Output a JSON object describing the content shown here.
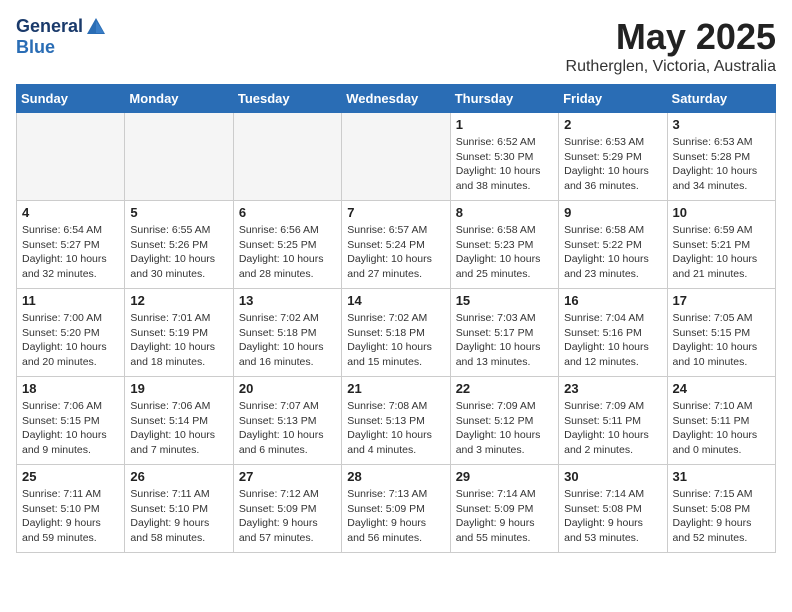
{
  "logo": {
    "line1": "General",
    "line2": "Blue"
  },
  "title": "May 2025",
  "subtitle": "Rutherglen, Victoria, Australia",
  "weekdays": [
    "Sunday",
    "Monday",
    "Tuesday",
    "Wednesday",
    "Thursday",
    "Friday",
    "Saturday"
  ],
  "weeks": [
    [
      {
        "day": "",
        "info": ""
      },
      {
        "day": "",
        "info": ""
      },
      {
        "day": "",
        "info": ""
      },
      {
        "day": "",
        "info": ""
      },
      {
        "day": "1",
        "info": "Sunrise: 6:52 AM\nSunset: 5:30 PM\nDaylight: 10 hours\nand 38 minutes."
      },
      {
        "day": "2",
        "info": "Sunrise: 6:53 AM\nSunset: 5:29 PM\nDaylight: 10 hours\nand 36 minutes."
      },
      {
        "day": "3",
        "info": "Sunrise: 6:53 AM\nSunset: 5:28 PM\nDaylight: 10 hours\nand 34 minutes."
      }
    ],
    [
      {
        "day": "4",
        "info": "Sunrise: 6:54 AM\nSunset: 5:27 PM\nDaylight: 10 hours\nand 32 minutes."
      },
      {
        "day": "5",
        "info": "Sunrise: 6:55 AM\nSunset: 5:26 PM\nDaylight: 10 hours\nand 30 minutes."
      },
      {
        "day": "6",
        "info": "Sunrise: 6:56 AM\nSunset: 5:25 PM\nDaylight: 10 hours\nand 28 minutes."
      },
      {
        "day": "7",
        "info": "Sunrise: 6:57 AM\nSunset: 5:24 PM\nDaylight: 10 hours\nand 27 minutes."
      },
      {
        "day": "8",
        "info": "Sunrise: 6:58 AM\nSunset: 5:23 PM\nDaylight: 10 hours\nand 25 minutes."
      },
      {
        "day": "9",
        "info": "Sunrise: 6:58 AM\nSunset: 5:22 PM\nDaylight: 10 hours\nand 23 minutes."
      },
      {
        "day": "10",
        "info": "Sunrise: 6:59 AM\nSunset: 5:21 PM\nDaylight: 10 hours\nand 21 minutes."
      }
    ],
    [
      {
        "day": "11",
        "info": "Sunrise: 7:00 AM\nSunset: 5:20 PM\nDaylight: 10 hours\nand 20 minutes."
      },
      {
        "day": "12",
        "info": "Sunrise: 7:01 AM\nSunset: 5:19 PM\nDaylight: 10 hours\nand 18 minutes."
      },
      {
        "day": "13",
        "info": "Sunrise: 7:02 AM\nSunset: 5:18 PM\nDaylight: 10 hours\nand 16 minutes."
      },
      {
        "day": "14",
        "info": "Sunrise: 7:02 AM\nSunset: 5:18 PM\nDaylight: 10 hours\nand 15 minutes."
      },
      {
        "day": "15",
        "info": "Sunrise: 7:03 AM\nSunset: 5:17 PM\nDaylight: 10 hours\nand 13 minutes."
      },
      {
        "day": "16",
        "info": "Sunrise: 7:04 AM\nSunset: 5:16 PM\nDaylight: 10 hours\nand 12 minutes."
      },
      {
        "day": "17",
        "info": "Sunrise: 7:05 AM\nSunset: 5:15 PM\nDaylight: 10 hours\nand 10 minutes."
      }
    ],
    [
      {
        "day": "18",
        "info": "Sunrise: 7:06 AM\nSunset: 5:15 PM\nDaylight: 10 hours\nand 9 minutes."
      },
      {
        "day": "19",
        "info": "Sunrise: 7:06 AM\nSunset: 5:14 PM\nDaylight: 10 hours\nand 7 minutes."
      },
      {
        "day": "20",
        "info": "Sunrise: 7:07 AM\nSunset: 5:13 PM\nDaylight: 10 hours\nand 6 minutes."
      },
      {
        "day": "21",
        "info": "Sunrise: 7:08 AM\nSunset: 5:13 PM\nDaylight: 10 hours\nand 4 minutes."
      },
      {
        "day": "22",
        "info": "Sunrise: 7:09 AM\nSunset: 5:12 PM\nDaylight: 10 hours\nand 3 minutes."
      },
      {
        "day": "23",
        "info": "Sunrise: 7:09 AM\nSunset: 5:11 PM\nDaylight: 10 hours\nand 2 minutes."
      },
      {
        "day": "24",
        "info": "Sunrise: 7:10 AM\nSunset: 5:11 PM\nDaylight: 10 hours\nand 0 minutes."
      }
    ],
    [
      {
        "day": "25",
        "info": "Sunrise: 7:11 AM\nSunset: 5:10 PM\nDaylight: 9 hours\nand 59 minutes."
      },
      {
        "day": "26",
        "info": "Sunrise: 7:11 AM\nSunset: 5:10 PM\nDaylight: 9 hours\nand 58 minutes."
      },
      {
        "day": "27",
        "info": "Sunrise: 7:12 AM\nSunset: 5:09 PM\nDaylight: 9 hours\nand 57 minutes."
      },
      {
        "day": "28",
        "info": "Sunrise: 7:13 AM\nSunset: 5:09 PM\nDaylight: 9 hours\nand 56 minutes."
      },
      {
        "day": "29",
        "info": "Sunrise: 7:14 AM\nSunset: 5:09 PM\nDaylight: 9 hours\nand 55 minutes."
      },
      {
        "day": "30",
        "info": "Sunrise: 7:14 AM\nSunset: 5:08 PM\nDaylight: 9 hours\nand 53 minutes."
      },
      {
        "day": "31",
        "info": "Sunrise: 7:15 AM\nSunset: 5:08 PM\nDaylight: 9 hours\nand 52 minutes."
      }
    ]
  ]
}
